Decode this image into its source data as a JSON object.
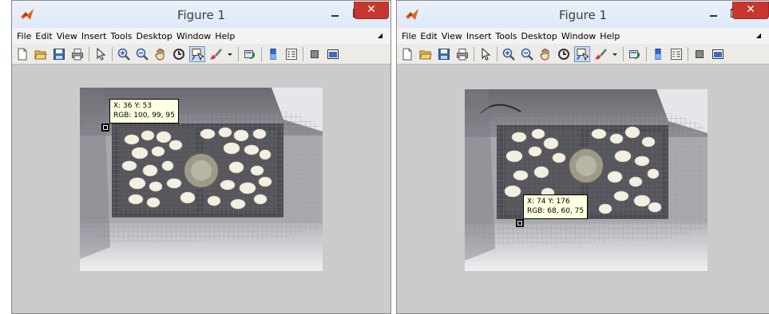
{
  "windows": [
    {
      "title": "Figure 1",
      "close_glyph": "✕",
      "menu": [
        "File",
        "Edit",
        "View",
        "Insert",
        "Tools",
        "Desktop",
        "Window",
        "Help"
      ],
      "datatip": {
        "line1": "X: 36 Y: 53",
        "line2": "RGB: 100, 99, 95"
      }
    },
    {
      "title": "Figure 1",
      "close_glyph": "✕",
      "menu": [
        "File",
        "Edit",
        "View",
        "Insert",
        "Tools",
        "Desktop",
        "Window",
        "Help"
      ],
      "datatip": {
        "line1": "X: 74 Y: 176",
        "line2": "RGB: 68, 60, 75"
      }
    }
  ],
  "toolbar_icons": [
    "new-figure-icon",
    "open-file-icon",
    "save-icon",
    "print-icon",
    "edit-plot-arrow-icon",
    "zoom-in-icon",
    "zoom-out-icon",
    "pan-hand-icon",
    "rotate-3d-icon",
    "data-cursor-icon",
    "brush-icon",
    "brush-dropdown-icon",
    "link-plot-icon",
    "colorbar-icon",
    "legend-icon",
    "hide-plot-tools-icon",
    "show-plot-tools-icon"
  ],
  "colors": {
    "titlebar": "#dfe9f7",
    "close_button": "#c7372f",
    "canvas": "#cbcbcb",
    "datatip_bg": "#ffffe1"
  }
}
